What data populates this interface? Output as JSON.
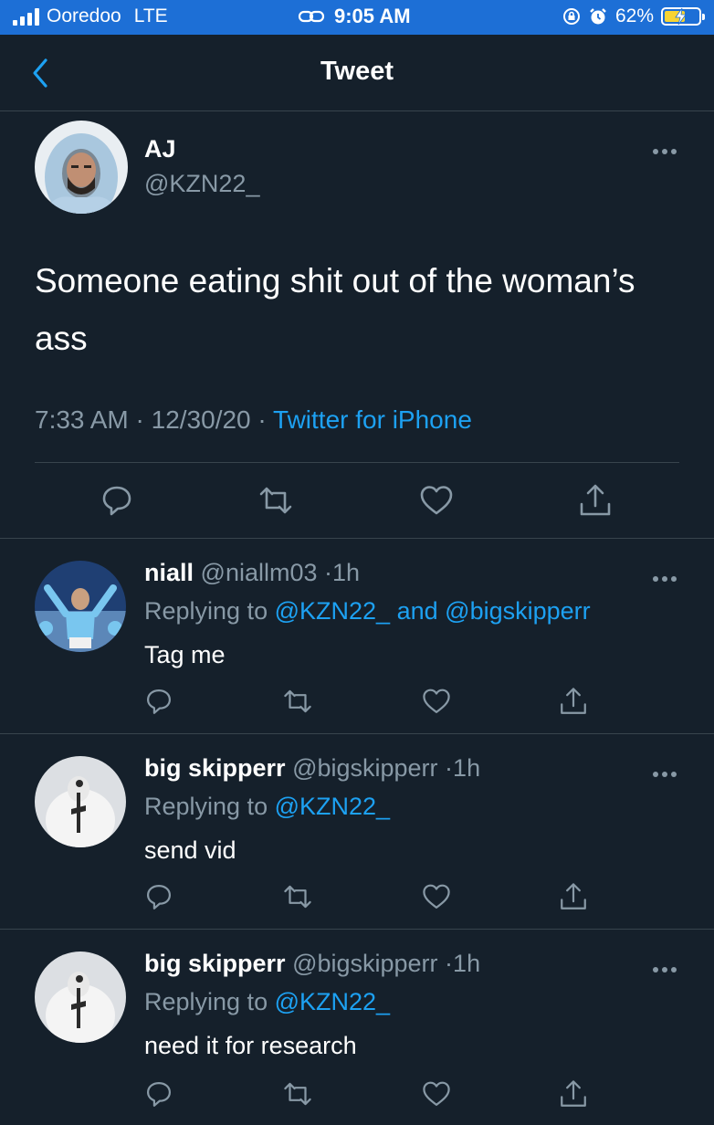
{
  "status_bar": {
    "carrier": "Ooredoo",
    "network": "LTE",
    "time": "9:05 AM",
    "battery": "62%",
    "battery_level": 0.62,
    "battery_fill_color": "#f7d433",
    "background_color": "#1d6fd6"
  },
  "nav": {
    "title": "Tweet",
    "back_icon": "chevron-left-icon",
    "accent_color": "#1da1f2"
  },
  "tweet": {
    "name": "AJ",
    "handle": "@KZN22_",
    "text": "Someone eating shit out of the woman’s ass",
    "time": "7:33 AM",
    "date": "12/30/20",
    "separator": "·",
    "source": "Twitter for iPhone",
    "actions": [
      "reply-icon",
      "retweet-icon",
      "like-icon",
      "share-icon"
    ]
  },
  "replies": [
    {
      "name": "niall",
      "handle": "@niallm03",
      "separator": "·",
      "time": "1h",
      "replying_prefix": "Replying to",
      "mention_1": "@KZN22_",
      "connector": "and",
      "mention_2": "@bigskipperr",
      "text": "Tag me"
    },
    {
      "name": "big skipperr",
      "handle": "@bigskipperr",
      "separator": "·",
      "time": "1h",
      "replying_prefix": "Replying to",
      "mention_1": "@KZN22_",
      "text": "send vid"
    },
    {
      "name": "big skipperr",
      "handle": "@bigskipperr",
      "separator": "·",
      "time": "1h",
      "replying_prefix": "Replying to",
      "mention_1": "@KZN22_",
      "text": "need it for research"
    }
  ],
  "colors": {
    "background": "#15202b",
    "secondary_text": "#8899a6",
    "divider": "#38444d",
    "link": "#1da1f2"
  }
}
